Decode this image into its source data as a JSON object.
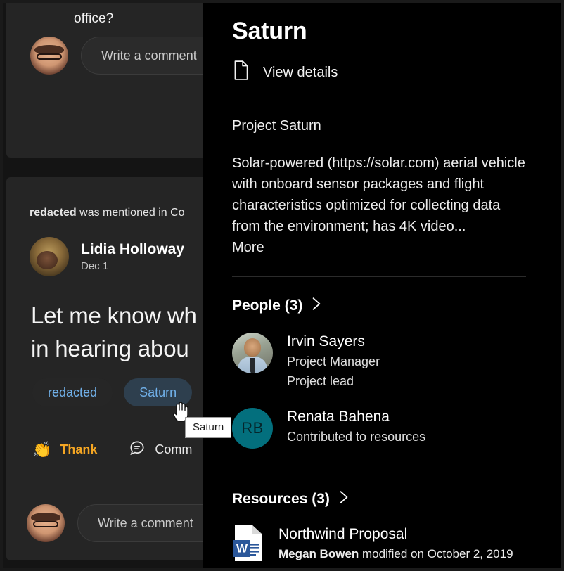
{
  "feed": {
    "post_top": {
      "tail_text": "office?",
      "actions": [
        "like-icon",
        "comment-icon",
        "share-icon",
        "chevron-down-icon"
      ],
      "comment_placeholder": "Write a comment"
    },
    "post_bottom": {
      "mention_text_bold": "redacted",
      "mention_text_rest": " was mentioned in Co",
      "author_name": "Lidia Holloway",
      "author_date": "Dec 1",
      "body_line1": "Let me know wh",
      "body_line2": "in hearing abou",
      "tags": [
        {
          "label": "redacted",
          "hovered": false
        },
        {
          "label": "Saturn",
          "hovered": true
        }
      ],
      "reactions": [
        {
          "label": "Thank",
          "icon": "clap-emoji",
          "color": "#f5a623"
        },
        {
          "label": "Comm",
          "icon": "comment-icon",
          "color": "#e8e8e8"
        }
      ],
      "comment_placeholder": "Write a comment"
    },
    "tooltip": "Saturn"
  },
  "flyout": {
    "title": "Saturn",
    "view_details": "View details",
    "project_name": "Project Saturn",
    "description": "Solar-powered (https://solar.com) aerial vehicle with onboard sensor packages and flight characteristics optimized for collecting data from the environment; has 4K video...",
    "more_label": "More",
    "people": {
      "heading": "People (3)",
      "items": [
        {
          "name": "Irvin Sayers",
          "role": "Project Manager",
          "relation": "Project lead",
          "avatar_type": "photo",
          "initials": ""
        },
        {
          "name": "Renata Bahena",
          "role": "Contributed to resources",
          "relation": "",
          "avatar_type": "initials",
          "initials": "RB"
        }
      ]
    },
    "resources": {
      "heading": "Resources (3)",
      "items": [
        {
          "name": "Northwind Proposal",
          "modifier": "Megan Bowen",
          "modified_suffix": " modified on October 2, 2019",
          "icon": "word-document-icon"
        }
      ]
    }
  },
  "scrollbar": {
    "up_arrow": "scroll-up-arrow",
    "down_arrow": "scroll-down-arrow"
  },
  "colors": {
    "panel_bg": "#000000",
    "feed_bg": "#141414",
    "card_bg": "#252525",
    "tag_text": "#71b1ea",
    "tag_hover_bg": "#2e3f4e",
    "thank_orange": "#f5a623",
    "avatar_teal": "#036f7d",
    "word_blue": "#2b579a"
  }
}
